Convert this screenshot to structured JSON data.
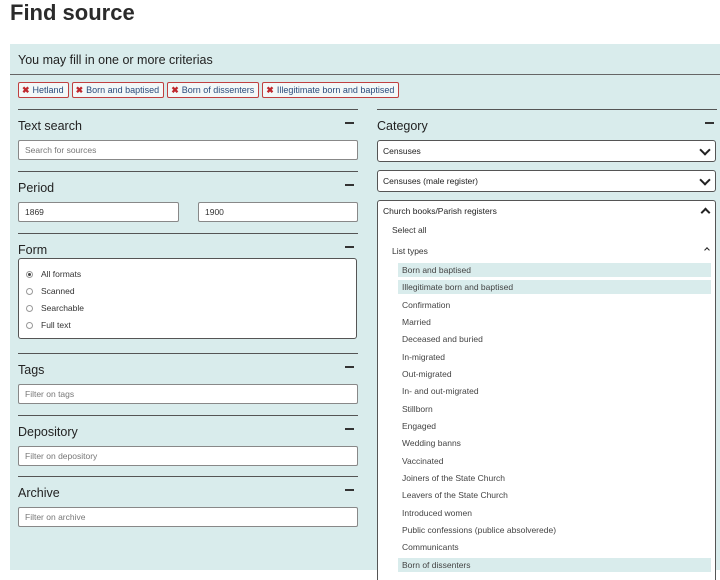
{
  "page_title": "Find source",
  "intro": "You may fill in one or more criterias",
  "chips": [
    {
      "label": "Hetland"
    },
    {
      "label": "Born and baptised"
    },
    {
      "label": "Born of dissenters"
    },
    {
      "label": "Illegitimate born and baptised"
    }
  ],
  "text_search": {
    "heading": "Text search",
    "placeholder": "Search for sources"
  },
  "period": {
    "heading": "Period",
    "from": "1869",
    "to": "1900"
  },
  "form": {
    "heading": "Form",
    "options": [
      "All formats",
      "Scanned",
      "Searchable",
      "Full text"
    ],
    "selected": "All formats"
  },
  "tags": {
    "heading": "Tags",
    "placeholder": "Filter on tags"
  },
  "depository": {
    "heading": "Depository",
    "placeholder": "Filter on depository"
  },
  "archive": {
    "heading": "Archive",
    "placeholder": "Filter on archive"
  },
  "category": {
    "heading": "Category",
    "select1": "Censuses",
    "select2": "Censuses (male register)",
    "church": {
      "title": "Church books/Parish registers",
      "select_all": "Select all",
      "list_types_label": "List types",
      "items": [
        {
          "label": "Born and baptised",
          "selected": true
        },
        {
          "label": "Illegitimate born and baptised",
          "selected": true
        },
        {
          "label": "Confirmation",
          "selected": false
        },
        {
          "label": "Married",
          "selected": false
        },
        {
          "label": "Deceased and buried",
          "selected": false
        },
        {
          "label": "In-migrated",
          "selected": false
        },
        {
          "label": "Out-migrated",
          "selected": false
        },
        {
          "label": "In- and out-migrated",
          "selected": false
        },
        {
          "label": "Stillborn",
          "selected": false
        },
        {
          "label": "Engaged",
          "selected": false
        },
        {
          "label": "Wedding banns",
          "selected": false
        },
        {
          "label": "Vaccinated",
          "selected": false
        },
        {
          "label": "Joiners of the State Church",
          "selected": false
        },
        {
          "label": "Leavers of the State Church",
          "selected": false
        },
        {
          "label": "Introduced women",
          "selected": false
        },
        {
          "label": "Public confessions (publice absolverede)",
          "selected": false
        },
        {
          "label": "Communicants",
          "selected": false
        },
        {
          "label": "Born of dissenters",
          "selected": true
        }
      ]
    }
  },
  "icons": {
    "chip_remove": "close-icon",
    "collapse": "minus-icon",
    "dropdown": "chevron-down-icon",
    "collapse_up": "chevron-up-icon"
  },
  "colors": {
    "panel_bg": "#d9ecec",
    "chip_border": "#c04040",
    "chip_x": "#c0282d",
    "selected_item_bg": "#d9ecec"
  }
}
